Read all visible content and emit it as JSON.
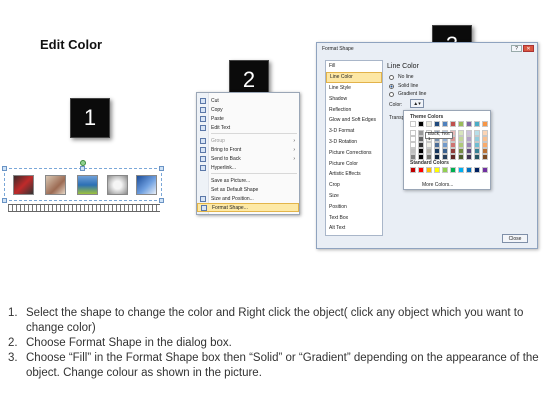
{
  "slide": {
    "title": "Edit Color",
    "badges": [
      "1",
      "2",
      "3"
    ]
  },
  "context_menu": {
    "items": [
      {
        "label": "Cut",
        "icon": "scissors-icon",
        "disabled": false
      },
      {
        "label": "Copy",
        "icon": "copy-icon",
        "disabled": false
      },
      {
        "label": "Paste",
        "icon": "paste-icon",
        "disabled": false
      },
      {
        "label": "Edit Text",
        "icon": "edit-text-icon",
        "disabled": false
      },
      {
        "label": "Group",
        "icon": "group-icon",
        "disabled": true,
        "submenu": true
      },
      {
        "label": "Bring to Front",
        "icon": "bring-front-icon",
        "disabled": false,
        "submenu": true
      },
      {
        "label": "Send to Back",
        "icon": "send-back-icon",
        "disabled": false,
        "submenu": true
      },
      {
        "label": "Hyperlink...",
        "icon": "hyperlink-icon",
        "disabled": false
      },
      {
        "label": "Save as Picture...",
        "icon": "",
        "disabled": false
      },
      {
        "label": "Set as Default Shape",
        "icon": "",
        "disabled": false
      },
      {
        "label": "Size and Position...",
        "icon": "size-icon",
        "disabled": false
      },
      {
        "label": "Format Shape...",
        "icon": "format-shape-icon",
        "disabled": false,
        "highlighted": true
      }
    ]
  },
  "format_dialog": {
    "title": "Format Shape",
    "categories": [
      "Fill",
      "Line Color",
      "Line Style",
      "Shadow",
      "Reflection",
      "Glow and Soft Edges",
      "3-D Format",
      "3-D Rotation",
      "Picture Corrections",
      "Picture Color",
      "Artistic Effects",
      "Crop",
      "Size",
      "Position",
      "Text Box",
      "Alt Text"
    ],
    "selected_category": "Line Color",
    "panel_title": "Line Color",
    "options": [
      "No line",
      "Solid line",
      "Gradient line"
    ],
    "selected_option": "Solid line",
    "color_label": "Color:",
    "transparency_label": "Transpa",
    "close_label": "Close"
  },
  "palette": {
    "theme_header": "Theme Colors",
    "standard_header": "Standard Colors",
    "more_label": "More Colors...",
    "tooltip": "Black, Text 1",
    "theme_top_row": [
      "#ffffff",
      "#000000",
      "#eeece1",
      "#1f497d",
      "#4f81bd",
      "#c0504d",
      "#9bbb59",
      "#8064a2",
      "#4bacc6",
      "#f79646"
    ],
    "standard_colors": [
      "#c00000",
      "#ff0000",
      "#ffc000",
      "#ffff00",
      "#92d050",
      "#00b050",
      "#00b0f0",
      "#0070c0",
      "#002060",
      "#7030a0"
    ]
  },
  "instructions": [
    {
      "num": "1.",
      "text": "Select the shape to change the color and Right click the object( click any object which you want to change color)"
    },
    {
      "num": "2.",
      "text": "Choose Format Shape in the dialog box."
    },
    {
      "num": "3.",
      "text": "Choose “Fill” in the Format Shape box then “Solid” or “Gradient” depending on the appearance of the object. Change colour as shown in the picture."
    }
  ]
}
